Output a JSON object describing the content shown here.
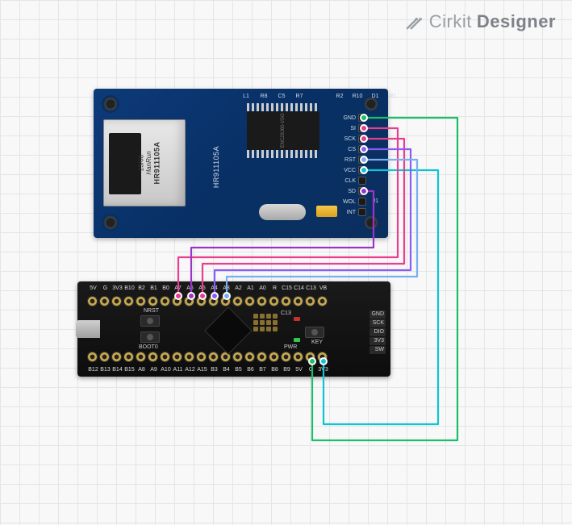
{
  "logo": {
    "brand": "Cirkit",
    "product": "Designer"
  },
  "ethernet": {
    "rj45": {
      "part": "HR911105A",
      "maker": "HanRun",
      "date": "23/08"
    },
    "board_label": "HR911105A",
    "chip_label": "ENC28J60-I/SO",
    "top_smd_left": [
      "L1",
      "R8",
      "C5",
      "R7"
    ],
    "top_smd_right": [
      "R2",
      "R10",
      "D1",
      "R1"
    ],
    "pins": [
      "GND",
      "SI",
      "SCK",
      "CS",
      "RST",
      "VCC",
      "CLK",
      "SD",
      "WOL",
      "INT"
    ]
  },
  "stm32": {
    "top_pins": [
      "5V",
      "G",
      "3V3",
      "B10",
      "B2",
      "B1",
      "B0",
      "A7",
      "A6",
      "A5",
      "A4",
      "A3",
      "A2",
      "A1",
      "A0",
      "R",
      "C15",
      "C14",
      "C13",
      "VB"
    ],
    "bottom_pins": [
      "B12",
      "B13",
      "B14",
      "B15",
      "A8",
      "A9",
      "A10",
      "A11",
      "A12",
      "A15",
      "B3",
      "B4",
      "B5",
      "B6",
      "B7",
      "B8",
      "B9",
      "5V",
      "G",
      "3V3"
    ],
    "side_labels": [
      "GND",
      "SCK",
      "DIO",
      "3V3",
      "SW"
    ],
    "btn_nrst": "NRST",
    "btn_boot": "BOOT0",
    "btn_key": "KEY",
    "led_c13": "C13",
    "led_pwr": "PWR"
  },
  "wires": [
    {
      "name": "GND",
      "color": "#1bbf68",
      "from": "eth.GND",
      "to": "stm.bottom.G"
    },
    {
      "name": "SI",
      "color": "#e83e8c",
      "from": "eth.SI",
      "to": "stm.top.A7"
    },
    {
      "name": "SCK",
      "color": "#e83e8c",
      "from": "eth.SCK",
      "to": "stm.top.A5"
    },
    {
      "name": "CS",
      "color": "#8a5cf6",
      "from": "eth.CS",
      "to": "stm.top.A4"
    },
    {
      "name": "RST",
      "color": "#7aaef0",
      "from": "eth.RST",
      "to": "stm.top.A3"
    },
    {
      "name": "VCC",
      "color": "#0fc4d4",
      "from": "eth.VCC",
      "to": "stm.bottom.3V3"
    },
    {
      "name": "SD",
      "color": "#9c34c9",
      "from": "eth.SD",
      "to": "stm.top.A6"
    }
  ],
  "colors": {
    "green": "#1bbf68",
    "pink": "#e83e8c",
    "purple": "#8a5cf6",
    "lightblue": "#7aaef0",
    "teal": "#0fc4d4",
    "violet": "#9c34c9"
  }
}
